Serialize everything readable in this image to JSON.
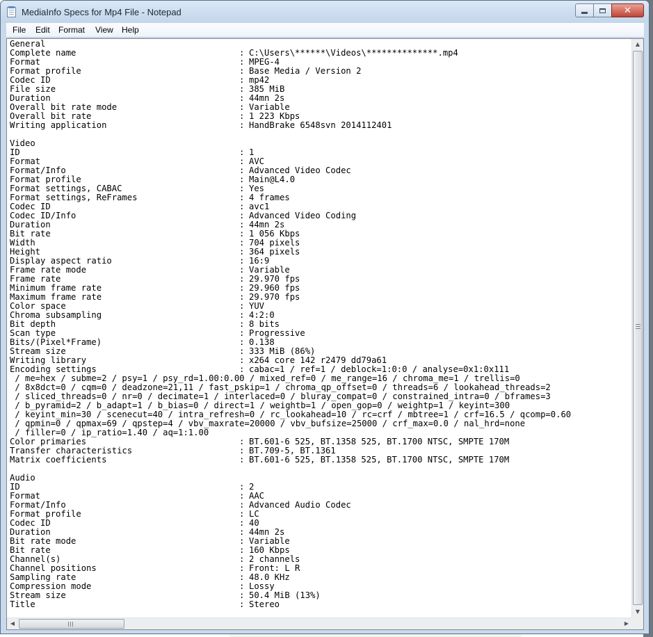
{
  "window": {
    "title": "MediaInfo Specs for Mp4 File - Notepad",
    "icon": "notepad-icon"
  },
  "controls": {
    "minimize_icon": "minimize-icon",
    "maximize_icon": "maximize-icon",
    "close_glyph": "✕"
  },
  "menu": [
    "File",
    "Edit",
    "Format",
    "View",
    "Help"
  ],
  "content": [
    {
      "label": "General"
    },
    {
      "label": "Complete name",
      "value": "C:\\Users\\******\\Videos\\**************.mp4"
    },
    {
      "label": "Format",
      "value": "MPEG-4"
    },
    {
      "label": "Format profile",
      "value": "Base Media / Version 2"
    },
    {
      "label": "Codec ID",
      "value": "mp42"
    },
    {
      "label": "File size",
      "value": "385 MiB"
    },
    {
      "label": "Duration",
      "value": "44mn 2s"
    },
    {
      "label": "Overall bit rate mode",
      "value": "Variable"
    },
    {
      "label": "Overall bit rate",
      "value": "1 223 Kbps"
    },
    {
      "label": "Writing application",
      "value": "HandBrake 6548svn 2014112401"
    },
    {
      "label": ""
    },
    {
      "label": "Video"
    },
    {
      "label": "ID",
      "value": "1"
    },
    {
      "label": "Format",
      "value": "AVC"
    },
    {
      "label": "Format/Info",
      "value": "Advanced Video Codec"
    },
    {
      "label": "Format profile",
      "value": "Main@L4.0"
    },
    {
      "label": "Format settings, CABAC",
      "value": "Yes"
    },
    {
      "label": "Format settings, ReFrames",
      "value": "4 frames"
    },
    {
      "label": "Codec ID",
      "value": "avc1"
    },
    {
      "label": "Codec ID/Info",
      "value": "Advanced Video Coding"
    },
    {
      "label": "Duration",
      "value": "44mn 2s"
    },
    {
      "label": "Bit rate",
      "value": "1 056 Kbps"
    },
    {
      "label": "Width",
      "value": "704 pixels"
    },
    {
      "label": "Height",
      "value": "364 pixels"
    },
    {
      "label": "Display aspect ratio",
      "value": "16:9"
    },
    {
      "label": "Frame rate mode",
      "value": "Variable"
    },
    {
      "label": "Frame rate",
      "value": "29.970 fps"
    },
    {
      "label": "Minimum frame rate",
      "value": "29.960 fps"
    },
    {
      "label": "Maximum frame rate",
      "value": "29.970 fps"
    },
    {
      "label": "Color space",
      "value": "YUV"
    },
    {
      "label": "Chroma subsampling",
      "value": "4:2:0"
    },
    {
      "label": "Bit depth",
      "value": "8 bits"
    },
    {
      "label": "Scan type",
      "value": "Progressive"
    },
    {
      "label": "Bits/(Pixel*Frame)",
      "value": "0.138"
    },
    {
      "label": "Stream size",
      "value": "333 MiB (86%)"
    },
    {
      "label": "Writing library",
      "value": "x264 core 142 r2479 dd79a61"
    },
    {
      "label": "Encoding settings",
      "value": "cabac=1 / ref=1 / deblock=1:0:0 / analyse=0x1:0x111"
    },
    {
      "continuation": " / me=hex / subme=2 / psy=1 / psy_rd=1.00:0.00 / mixed_ref=0 / me_range=16 / chroma_me=1 / trellis=0"
    },
    {
      "continuation": " / 8x8dct=0 / cqm=0 / deadzone=21,11 / fast_pskip=1 / chroma_qp_offset=0 / threads=6 / lookahead_threads=2"
    },
    {
      "continuation": " / sliced_threads=0 / nr=0 / decimate=1 / interlaced=0 / bluray_compat=0 / constrained_intra=0 / bframes=3"
    },
    {
      "continuation": " / b_pyramid=2 / b_adapt=1 / b_bias=0 / direct=1 / weightb=1 / open_gop=0 / weightp=1 / keyint=300"
    },
    {
      "continuation": " / keyint_min=30 / scenecut=40 / intra_refresh=0 / rc_lookahead=10 / rc=crf / mbtree=1 / crf=16.5 / qcomp=0.60"
    },
    {
      "continuation": " / qpmin=0 / qpmax=69 / qpstep=4 / vbv_maxrate=20000 / vbv_bufsize=25000 / crf_max=0.0 / nal_hrd=none"
    },
    {
      "continuation": " / filler=0 / ip_ratio=1.40 / aq=1:1.00"
    },
    {
      "label": "Color primaries",
      "value": "BT.601-6 525, BT.1358 525, BT.1700 NTSC, SMPTE 170M"
    },
    {
      "label": "Transfer characteristics",
      "value": "BT.709-5, BT.1361"
    },
    {
      "label": "Matrix coefficients",
      "value": "BT.601-6 525, BT.1358 525, BT.1700 NTSC, SMPTE 170M"
    },
    {
      "label": ""
    },
    {
      "label": "Audio"
    },
    {
      "label": "ID",
      "value": "2"
    },
    {
      "label": "Format",
      "value": "AAC"
    },
    {
      "label": "Format/Info",
      "value": "Advanced Audio Codec"
    },
    {
      "label": "Format profile",
      "value": "LC"
    },
    {
      "label": "Codec ID",
      "value": "40"
    },
    {
      "label": "Duration",
      "value": "44mn 2s"
    },
    {
      "label": "Bit rate mode",
      "value": "Variable"
    },
    {
      "label": "Bit rate",
      "value": "160 Kbps"
    },
    {
      "label": "Channel(s)",
      "value": "2 channels"
    },
    {
      "label": "Channel positions",
      "value": "Front: L R"
    },
    {
      "label": "Sampling rate",
      "value": "48.0 KHz"
    },
    {
      "label": "Compression mode",
      "value": "Lossy"
    },
    {
      "label": "Stream size",
      "value": "50.4 MiB (13%)"
    },
    {
      "label": "Title",
      "value": "Stereo"
    }
  ],
  "scrollbars": {
    "up_arrow": "▲",
    "down_arrow": "▼",
    "left_arrow": "◀",
    "right_arrow": "▶"
  }
}
